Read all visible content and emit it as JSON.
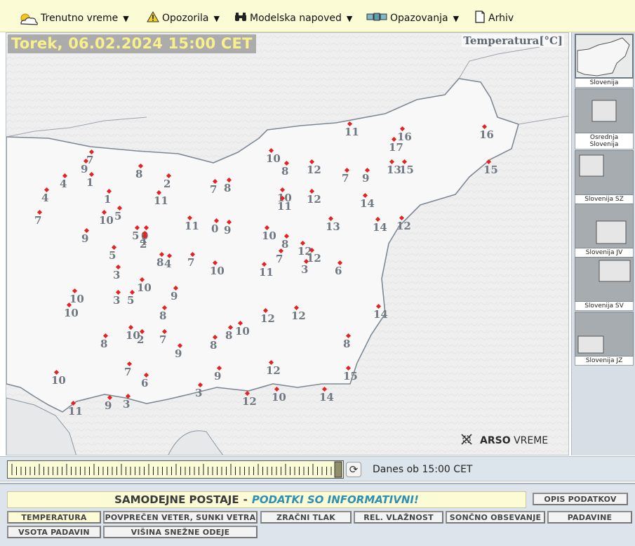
{
  "nav": {
    "items": [
      {
        "label": "Trenutno vreme",
        "icon": "sun-cloud-icon",
        "caret": true
      },
      {
        "label": "Opozorila",
        "icon": "warning-icon",
        "caret": true
      },
      {
        "label": "Modelska napoved",
        "icon": "binoculars-icon",
        "caret": true
      },
      {
        "label": "Opazovanja",
        "icon": "satellite-icon",
        "caret": true
      },
      {
        "label": "Arhiv",
        "icon": "document-icon",
        "caret": false
      }
    ]
  },
  "map": {
    "datetime": "Torek, 06.02.2024 15:00 CET",
    "parameter": "Temperatura[°C]",
    "logo_bold": "ARSO",
    "logo_text": "VREME",
    "station_values": [
      "11",
      "16",
      "17",
      "16",
      "13",
      "15",
      "15",
      "10",
      "8",
      "12",
      "7",
      "9",
      "12",
      "14",
      "9",
      "7",
      "4",
      "1",
      "8",
      "2",
      "7",
      "8",
      "11",
      "10",
      "11",
      "12",
      "13",
      "14",
      "4",
      "1",
      "5",
      "11",
      "0",
      "9",
      "10",
      "8",
      "7",
      "7",
      "10",
      "5",
      "0",
      "4",
      "2",
      "12",
      "12",
      "9",
      "5",
      "8",
      "4",
      "7",
      "10",
      "11",
      "3",
      "6",
      "3",
      "10",
      "9",
      "8",
      "10",
      "10",
      "3",
      "5",
      "8",
      "9",
      "12",
      "12",
      "14",
      "10",
      "2",
      "7",
      "8",
      "10",
      "8",
      "8",
      "9",
      "15",
      "7",
      "6",
      "3",
      "12",
      "10",
      "14",
      "10",
      "11",
      "9",
      "3",
      "12"
    ]
  },
  "regions": [
    {
      "label": "Slovenija",
      "active": true
    },
    {
      "label": "Osrednja Slovenija",
      "active": false
    },
    {
      "label": "Slovenija SZ",
      "active": false
    },
    {
      "label": "Slovenija JV",
      "active": false
    },
    {
      "label": "Slovenija SV",
      "active": false
    },
    {
      "label": "Slovenija JZ",
      "active": false
    }
  ],
  "timeline": {
    "status": "Danes ob 15:00 CET"
  },
  "bottom": {
    "title": "SAMODEJNE POSTAJE",
    "separator": "-",
    "info": "PODATKI SO INFORMATIVNI!",
    "description_button": "OPIS PODATKOV",
    "buttons": [
      "TEMPERATURA",
      "POVPREČEN VETER, SUNKI VETRA",
      "ZRAČNI TLAK",
      "REL. VLAŽNOST",
      "SONČNO OBSEVANJE",
      "PADAVINE",
      "VSOTA PADAVIN",
      "VIŠINA SNEŽNE ODEJE"
    ],
    "selected": "TEMPERATURA"
  },
  "colors": {
    "nav_bg": "#fbfbd5",
    "datetime_text": "#f8f08a",
    "station_dot": "#e82020",
    "station_value": "#6f7780",
    "info_text": "#2f8fb0"
  }
}
